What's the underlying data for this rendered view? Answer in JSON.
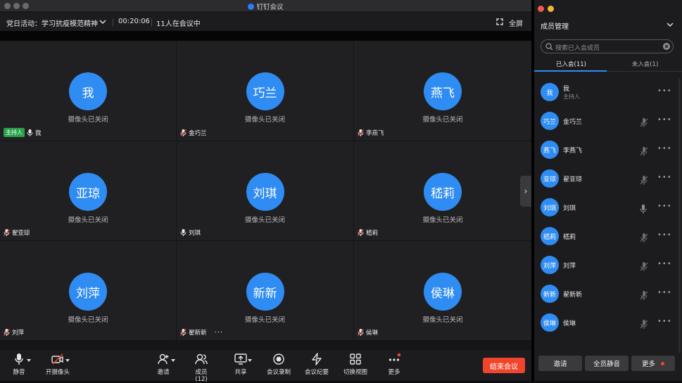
{
  "window": {
    "title": "钉钉会议"
  },
  "info": {
    "meeting": "党日活动：学习抗疫模范精神",
    "timer": "00:20:06",
    "attendance": "11人在会议中",
    "fullscreen": "全屏"
  },
  "tiles": [
    {
      "avatar": "我",
      "status": "摄像头已关闭",
      "name": "我",
      "host": "主持人",
      "mic": "on"
    },
    {
      "avatar": "巧兰",
      "status": "摄像头已关闭",
      "name": "金巧兰",
      "mic": "muted"
    },
    {
      "avatar": "燕飞",
      "status": "摄像头已关闭",
      "name": "李燕飞",
      "mic": "muted"
    },
    {
      "avatar": "亚琼",
      "status": "摄像头已关闭",
      "name": "翟亚琼",
      "mic": "muted"
    },
    {
      "avatar": "刘琪",
      "status": "摄像头已关闭",
      "name": "刘琪",
      "mic": "on"
    },
    {
      "avatar": "嵇莉",
      "status": "摄像头已关闭",
      "name": "嵇莉",
      "mic": "muted"
    },
    {
      "avatar": "刘萍",
      "status": "摄像头已关闭",
      "name": "刘萍",
      "mic": "muted"
    },
    {
      "avatar": "新新",
      "status": "摄像头已关闭",
      "name": "翟新新",
      "mic": "muted",
      "more": "···"
    },
    {
      "avatar": "侯琳",
      "status": "摄像头已关闭",
      "name": "侯琳",
      "mic": "muted"
    }
  ],
  "toolbar": {
    "mute": "静音",
    "camera": "开摄像头",
    "invite": "邀请",
    "members": "成员(12)",
    "share": "共享",
    "record": "会议录制",
    "minutes": "会议纪要",
    "view": "切换视图",
    "more": "更多",
    "end": "结束会议"
  },
  "panel": {
    "title": "成员管理",
    "search_placeholder": "搜索已入会成员",
    "tab_joined": "已入会(11)",
    "tab_notjoined": "未入会(1)",
    "members": [
      {
        "avatar": "我",
        "name": "我",
        "role": "主持人"
      },
      {
        "avatar": "巧兰",
        "name": "金巧兰",
        "mic": "muted"
      },
      {
        "avatar": "燕飞",
        "name": "李燕飞",
        "mic": "muted"
      },
      {
        "avatar": "亚琼",
        "name": "翟亚琼",
        "mic": "muted"
      },
      {
        "avatar": "刘琪",
        "name": "刘琪",
        "mic": "on"
      },
      {
        "avatar": "嵇莉",
        "name": "嵇莉",
        "mic": "muted"
      },
      {
        "avatar": "刘萍",
        "name": "刘萍",
        "mic": "muted"
      },
      {
        "avatar": "新新",
        "name": "翟新新",
        "mic": "muted"
      },
      {
        "avatar": "侯琳",
        "name": "侯琳",
        "mic": "muted"
      }
    ],
    "more_dots": "•••",
    "invite": "邀请",
    "mute_all": "全员静音",
    "more": "更多"
  },
  "colors": {
    "accent": "#2f8cf2",
    "host_badge": "#27a14a",
    "end_button": "#f0452c"
  }
}
